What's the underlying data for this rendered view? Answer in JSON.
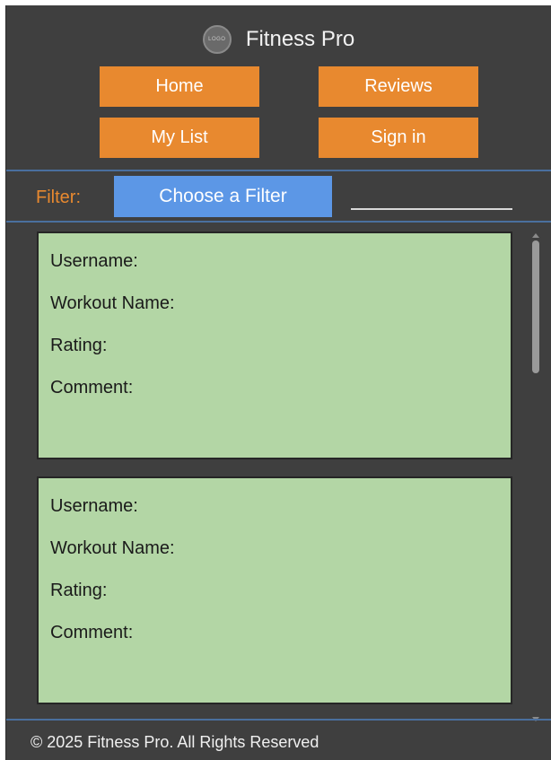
{
  "header": {
    "logo_text": "LOGO",
    "title": "Fitness Pro"
  },
  "nav": {
    "home": "Home",
    "reviews": "Reviews",
    "my_list": "My List",
    "sign_in": "Sign in"
  },
  "filter": {
    "label": "Filter:",
    "button": "Choose a Filter",
    "value": ""
  },
  "reviews": [
    {
      "username_label": "Username:",
      "workout_label": "Workout Name:",
      "rating_label": "Rating:",
      "comment_label": "Comment:"
    },
    {
      "username_label": "Username:",
      "workout_label": "Workout Name:",
      "rating_label": "Rating:",
      "comment_label": "Comment:"
    }
  ],
  "footer": {
    "text": "© 2025 Fitness Pro. All Rights Reserved"
  },
  "colors": {
    "background": "#3f3f3f",
    "accent_orange": "#e8892f",
    "filter_blue": "#5c97e6",
    "card_green": "#b3d6a5",
    "divider_blue": "#4a6f9e"
  }
}
